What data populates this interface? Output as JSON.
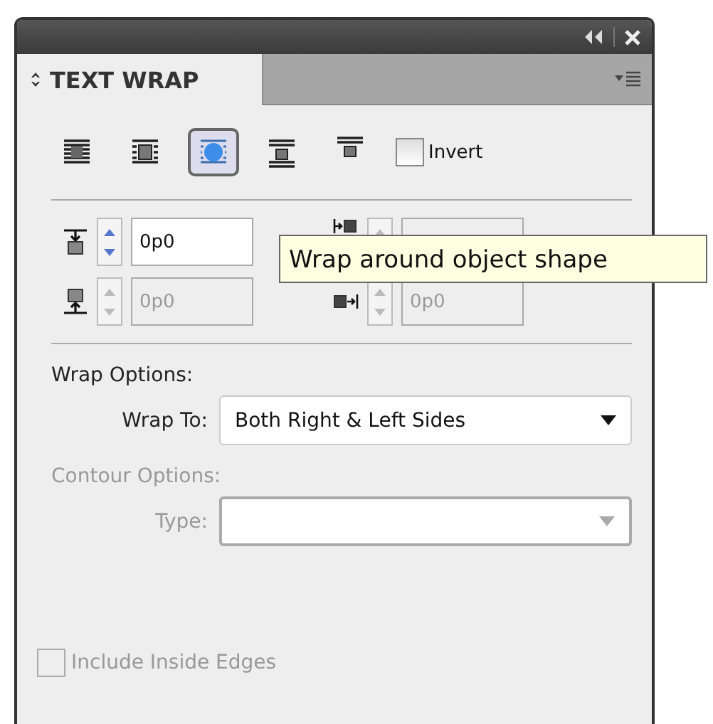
{
  "panel": {
    "title": "TEXT WRAP"
  },
  "wrap_modes": [
    {
      "kind": "none",
      "selected": false
    },
    {
      "kind": "box",
      "selected": false
    },
    {
      "kind": "shape",
      "selected": true
    },
    {
      "kind": "jump",
      "selected": false
    },
    {
      "kind": "next",
      "selected": false
    }
  ],
  "invert": {
    "label": "Invert",
    "checked": false
  },
  "offsets": [
    {
      "kind": "top",
      "value": "0p0",
      "disabled": false
    },
    {
      "kind": "left",
      "disabled": true
    },
    {
      "kind": "bottom",
      "value": "0p0",
      "disabled": true
    },
    {
      "kind": "right",
      "value": "0p0",
      "disabled": true
    }
  ],
  "tooltip": "Wrap around object shape",
  "wrap_options": {
    "heading": "Wrap Options:",
    "label": "Wrap To:",
    "value": "Both Right & Left Sides"
  },
  "contour_options": {
    "heading": "Contour Options:",
    "label": "Type:",
    "disabled": true
  },
  "include_inside_edges": {
    "label": "Include Inside Edges",
    "checked": false,
    "disabled": true
  }
}
